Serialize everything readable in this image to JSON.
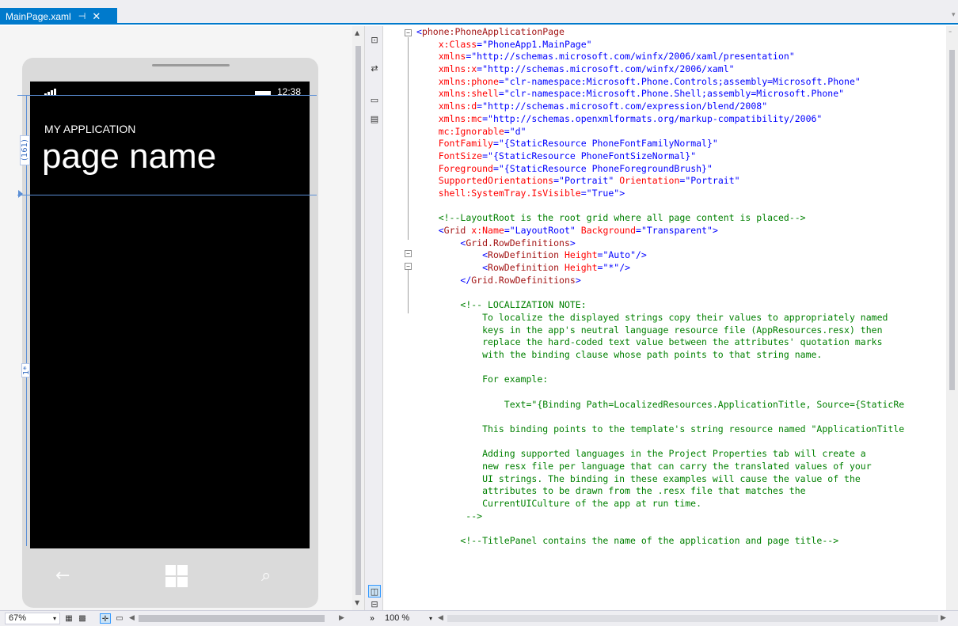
{
  "tab": {
    "title": "MainPage.xaml",
    "pin_icon": "⊣",
    "close_icon": "✕"
  },
  "phone": {
    "clock": "12:38",
    "app_title": "MY APPLICATION",
    "page_title": "page name",
    "row_label_top": "(161)",
    "row_label_mid": "1*",
    "nav_back_icon": "←",
    "nav_search_icon": "⌕"
  },
  "splitter": {
    "btn1": "⊡",
    "btn2": "⇄",
    "btn3": "▭",
    "btn4": "▤",
    "btn5": "◫",
    "btn6": "⊟",
    "btn7": "»"
  },
  "bottombar": {
    "zoom_design": "67%",
    "zoom_code": "100 %"
  },
  "code": {
    "lines": [
      [
        [
          "t-ang",
          "<"
        ],
        [
          "t-tag",
          "phone:PhoneApplicationPage"
        ]
      ],
      [
        [
          "t-def",
          "    "
        ],
        [
          "t-attr",
          "x:Class"
        ],
        [
          "t-val",
          "=\"PhoneApp1.MainPage\""
        ]
      ],
      [
        [
          "t-def",
          "    "
        ],
        [
          "t-attr",
          "xmlns"
        ],
        [
          "t-val",
          "=\"http://schemas.microsoft.com/winfx/2006/xaml/presentation\""
        ]
      ],
      [
        [
          "t-def",
          "    "
        ],
        [
          "t-attr",
          "xmlns:x"
        ],
        [
          "t-val",
          "=\"http://schemas.microsoft.com/winfx/2006/xaml\""
        ]
      ],
      [
        [
          "t-def",
          "    "
        ],
        [
          "t-attr",
          "xmlns:phone"
        ],
        [
          "t-val",
          "=\"clr-namespace:Microsoft.Phone.Controls;assembly=Microsoft.Phone\""
        ]
      ],
      [
        [
          "t-def",
          "    "
        ],
        [
          "t-attr",
          "xmlns:shell"
        ],
        [
          "t-val",
          "=\"clr-namespace:Microsoft.Phone.Shell;assembly=Microsoft.Phone\""
        ]
      ],
      [
        [
          "t-def",
          "    "
        ],
        [
          "t-attr",
          "xmlns:d"
        ],
        [
          "t-val",
          "=\"http://schemas.microsoft.com/expression/blend/2008\""
        ]
      ],
      [
        [
          "t-def",
          "    "
        ],
        [
          "t-attr",
          "xmlns:mc"
        ],
        [
          "t-val",
          "=\"http://schemas.openxmlformats.org/markup-compatibility/2006\""
        ]
      ],
      [
        [
          "t-def",
          "    "
        ],
        [
          "t-attr",
          "mc:Ignorable"
        ],
        [
          "t-val",
          "=\"d\""
        ]
      ],
      [
        [
          "t-def",
          "    "
        ],
        [
          "t-attr",
          "FontFamily"
        ],
        [
          "t-val",
          "=\"{StaticResource PhoneFontFamilyNormal}\""
        ]
      ],
      [
        [
          "t-def",
          "    "
        ],
        [
          "t-attr",
          "FontSize"
        ],
        [
          "t-val",
          "=\"{StaticResource PhoneFontSizeNormal}\""
        ]
      ],
      [
        [
          "t-def",
          "    "
        ],
        [
          "t-attr",
          "Foreground"
        ],
        [
          "t-val",
          "=\"{StaticResource PhoneForegroundBrush}\""
        ]
      ],
      [
        [
          "t-def",
          "    "
        ],
        [
          "t-attr",
          "SupportedOrientations"
        ],
        [
          "t-val",
          "=\"Portrait\""
        ],
        [
          "t-def",
          " "
        ],
        [
          "t-attr",
          "Orientation"
        ],
        [
          "t-val",
          "=\"Portrait\""
        ]
      ],
      [
        [
          "t-def",
          "    "
        ],
        [
          "t-attr",
          "shell:SystemTray.IsVisible"
        ],
        [
          "t-val",
          "=\"True\""
        ],
        [
          "t-ang",
          ">"
        ]
      ],
      [
        [
          "t-def",
          ""
        ]
      ],
      [
        [
          "t-def",
          "    "
        ],
        [
          "t-com",
          "<!--LayoutRoot is the root grid where all page content is placed-->"
        ]
      ],
      [
        [
          "t-def",
          "    "
        ],
        [
          "t-ang",
          "<"
        ],
        [
          "t-tag",
          "Grid"
        ],
        [
          "t-def",
          " "
        ],
        [
          "t-attr",
          "x:Name"
        ],
        [
          "t-val",
          "=\"LayoutRoot\""
        ],
        [
          "t-def",
          " "
        ],
        [
          "t-attr",
          "Background"
        ],
        [
          "t-val",
          "=\"Transparent\""
        ],
        [
          "t-ang",
          ">"
        ]
      ],
      [
        [
          "t-def",
          "        "
        ],
        [
          "t-ang",
          "<"
        ],
        [
          "t-tag",
          "Grid.RowDefinitions"
        ],
        [
          "t-ang",
          ">"
        ]
      ],
      [
        [
          "t-def",
          "            "
        ],
        [
          "t-ang",
          "<"
        ],
        [
          "t-tag",
          "RowDefinition"
        ],
        [
          "t-def",
          " "
        ],
        [
          "t-attr",
          "Height"
        ],
        [
          "t-val",
          "=\"Auto\""
        ],
        [
          "t-ang",
          "/>"
        ]
      ],
      [
        [
          "t-def",
          "            "
        ],
        [
          "t-ang",
          "<"
        ],
        [
          "t-tag",
          "RowDefinition"
        ],
        [
          "t-def",
          " "
        ],
        [
          "t-attr",
          "Height"
        ],
        [
          "t-val",
          "=\"*\""
        ],
        [
          "t-ang",
          "/>"
        ]
      ],
      [
        [
          "t-def",
          "        "
        ],
        [
          "t-ang",
          "</"
        ],
        [
          "t-tag",
          "Grid.RowDefinitions"
        ],
        [
          "t-ang",
          ">"
        ]
      ],
      [
        [
          "t-def",
          ""
        ]
      ],
      [
        [
          "t-def",
          "        "
        ],
        [
          "t-com",
          "<!-- LOCALIZATION NOTE:"
        ]
      ],
      [
        [
          "t-com",
          "            To localize the displayed strings copy their values to appropriately named"
        ]
      ],
      [
        [
          "t-com",
          "            keys in the app's neutral language resource file (AppResources.resx) then"
        ]
      ],
      [
        [
          "t-com",
          "            replace the hard-coded text value between the attributes' quotation marks"
        ]
      ],
      [
        [
          "t-com",
          "            with the binding clause whose path points to that string name."
        ]
      ],
      [
        [
          "t-def",
          ""
        ]
      ],
      [
        [
          "t-com",
          "            For example:"
        ]
      ],
      [
        [
          "t-def",
          ""
        ]
      ],
      [
        [
          "t-com",
          "                Text=\"{Binding Path=LocalizedResources.ApplicationTitle, Source={StaticRe"
        ]
      ],
      [
        [
          "t-def",
          ""
        ]
      ],
      [
        [
          "t-com",
          "            This binding points to the template's string resource named \"ApplicationTitle"
        ]
      ],
      [
        [
          "t-def",
          ""
        ]
      ],
      [
        [
          "t-com",
          "            Adding supported languages in the Project Properties tab will create a"
        ]
      ],
      [
        [
          "t-com",
          "            new resx file per language that can carry the translated values of your"
        ]
      ],
      [
        [
          "t-com",
          "            UI strings. The binding in these examples will cause the value of the"
        ]
      ],
      [
        [
          "t-com",
          "            attributes to be drawn from the .resx file that matches the"
        ]
      ],
      [
        [
          "t-com",
          "            CurrentUICulture of the app at run time."
        ]
      ],
      [
        [
          "t-com",
          "         -->"
        ]
      ],
      [
        [
          "t-def",
          ""
        ]
      ],
      [
        [
          "t-def",
          "        "
        ],
        [
          "t-com",
          "<!--TitlePanel contains the name of the application and page title-->"
        ]
      ]
    ]
  }
}
